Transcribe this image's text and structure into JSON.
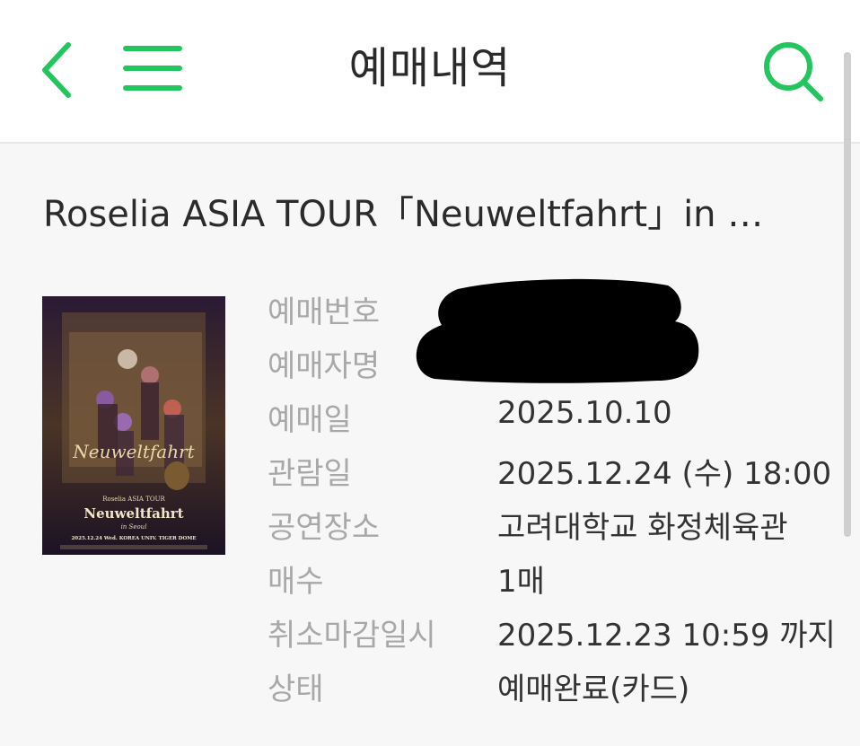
{
  "header": {
    "title": "예매내역",
    "back_icon": "chevron-left-icon",
    "menu_icon": "hamburger-menu-icon",
    "search_icon": "search-icon",
    "accent_color": "#22c55e"
  },
  "event": {
    "title": "Roselia ASIA TOUR「Neuweltfahrt」in …",
    "poster": {
      "series": "Roselia ASIA TOUR",
      "name": "Neuweltfahrt",
      "logo_text": "Neuweltfahrt",
      "city": "in Seoul",
      "date_venue": "2025.12.24 Wed.  KOREA UNIV. TIGER DOME"
    }
  },
  "details": [
    {
      "label": "예매번호",
      "value": ""
    },
    {
      "label": "예매자명",
      "value": ""
    },
    {
      "label": "예매일",
      "value": "2025.10.10"
    },
    {
      "label": "관람일",
      "value": "2025.12.24 (수) 18:00"
    },
    {
      "label": "공연장소",
      "value": "고려대학교 화정체육관"
    },
    {
      "label": "매수",
      "value": "1매"
    },
    {
      "label": "취소마감일시",
      "value": "2025.12.23 10:59 까지"
    },
    {
      "label": "상태",
      "value": "예매완료(카드)"
    }
  ]
}
